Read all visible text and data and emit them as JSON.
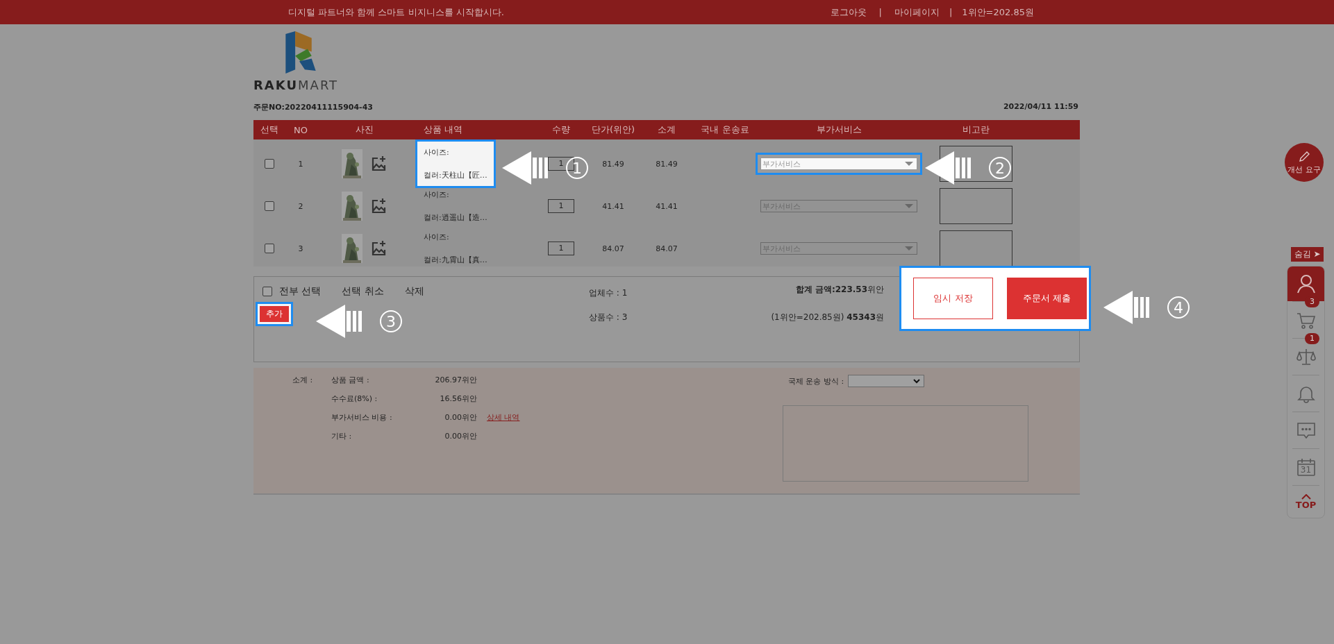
{
  "top_bar": {
    "slogan": "디지털 파트너와 함께 스마트 비지니스를 시작합시다.",
    "links": [
      "로그아웃",
      "마이페이지"
    ],
    "separators": [
      "|",
      "|"
    ],
    "rate": "1위안=202.85원"
  },
  "logo": {
    "text": "**RAKU**MART"
  },
  "order": {
    "number": "주문NO:20220411115904-43",
    "date": "2022/04/11 11:59"
  },
  "table": {
    "columns": [
      "선택",
      "NO",
      "사진",
      "상품 내역",
      "수량",
      "단가(위안)",
      "소계",
      "국내 운송료",
      "부가서비스",
      "비고란"
    ],
    "rows": [
      {
        "checked": false,
        "no": "1",
        "size": "사이즈:",
        "option": "컬러:天柱山【匠…",
        "quantity": "1",
        "unit_price": "81.49",
        "subtotal": "81.49",
        "service": "부가서비스",
        "highlighted": true
      },
      {
        "checked": false,
        "no": "2",
        "size": "사이즈:",
        "option": "컬러:逍遥山【造…",
        "quantity": "1",
        "unit_price": "41.41",
        "subtotal": "41.41",
        "service": "부가서비스",
        "highlighted": false
      },
      {
        "checked": false,
        "no": "3",
        "size": "사이즈:",
        "option": "컬러:九霄山【真…",
        "quantity": "1",
        "unit_price": "84.07",
        "subtotal": "84.07",
        "service": "부가서비스",
        "highlighted": false
      }
    ]
  },
  "actions": {
    "select_all": {
      "label": "전부 선택",
      "checked": false
    },
    "deselect": "선택 취소",
    "delete": "삭제",
    "add": {
      "label": "추가",
      "highlighted": true
    },
    "vendor_count": "업체수 : 1",
    "item_count": "상품수 : 3",
    "total": "**합계 금액:223.53**위안",
    "total_krw": "(1위안=202.85원) **45343**원",
    "save": "임시 저장",
    "submit": "주문서 제출",
    "buttons_highlighted": true
  },
  "summary": {
    "label": "소계 :",
    "lines": [
      {
        "label": "상품 금액 :",
        "value": "206.97위안"
      },
      {
        "label": "수수료(8%) :",
        "value": "16.56위안"
      },
      {
        "label": "부가서비스 비용 :",
        "value": "0.00위안"
      },
      {
        "label": "기타 :",
        "value": "0.00위안"
      }
    ],
    "detail_link": "상세 내역",
    "shipping_label": "국제 운송 방식 :"
  },
  "feedback_button": "개선 요구",
  "dock": {
    "hide": "숨김 ➤",
    "items": [
      {
        "kind": "user",
        "selected": true
      },
      {
        "kind": "cart",
        "selected": false,
        "badge": "3"
      },
      {
        "kind": "compare",
        "selected": false,
        "badge": "1"
      },
      {
        "kind": "bell",
        "selected": false
      },
      {
        "kind": "chat",
        "selected": false
      },
      {
        "kind": "calendar",
        "selected": false,
        "day": "31"
      },
      {
        "kind": "top",
        "selected": false,
        "label": "TOP"
      }
    ]
  },
  "callouts": [
    {
      "number": "1"
    },
    {
      "number": "2"
    },
    {
      "number": "3"
    },
    {
      "number": "4"
    }
  ]
}
